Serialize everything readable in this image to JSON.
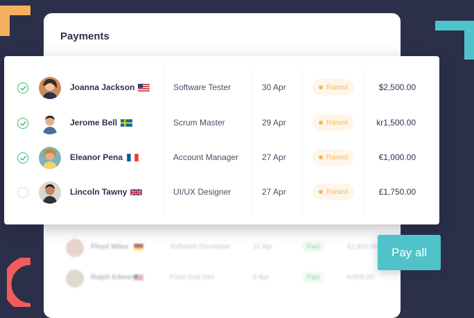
{
  "colors": {
    "background": "#2c2f4a",
    "accent_teal": "#4fc3c9",
    "accent_orange": "#f6b05f",
    "accent_red": "#f35c5c",
    "check_green": "#3dbb6e",
    "raised_badge": "#f5b55c",
    "paid_badge": "#46b86b"
  },
  "card": {
    "title": "Payments"
  },
  "payments": [
    {
      "selected": true,
      "name": "Joanna Jackson",
      "flag": "us-flag-icon",
      "role": "Software Tester",
      "date": "30 Apr",
      "status": "Raised",
      "amount": "$2,500.00"
    },
    {
      "selected": true,
      "name": "Jerome Bell",
      "flag": "se-flag-icon",
      "role": "Scrum Master",
      "date": "29 Apr",
      "status": "Raised",
      "amount": "kr1,500.00"
    },
    {
      "selected": true,
      "name": "Eleanor Pena",
      "flag": "fr-flag-icon",
      "role": "Account Manager",
      "date": "27 Apr",
      "status": "Raised",
      "amount": "€1,000.00"
    },
    {
      "selected": false,
      "name": "Lincoln Tawny",
      "flag": "uk-flag-icon",
      "role": "UI/UX Designer",
      "date": "27 Apr",
      "status": "Raised",
      "amount": "£1,750.00"
    }
  ],
  "background_rows": [
    {
      "name": "Floyd Miles",
      "flag": "de-flag-icon",
      "role": "Software Developer",
      "date": "11 Apr",
      "status": "Paid",
      "amount": "€1,800.00"
    },
    {
      "name": "Ralph Edwards",
      "flag": "us-flag-icon",
      "role": "Front End Dev",
      "date": "8 Apr",
      "status": "Paid",
      "amount": "kr900.00"
    }
  ],
  "actions": {
    "pay_all_label": "Pay all"
  }
}
